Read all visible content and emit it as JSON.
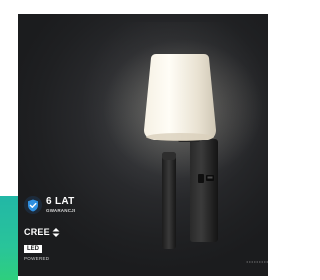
{
  "badges": {
    "warranty": {
      "big": "6 LAT",
      "small": "GWARANCJI",
      "icon": "shield-check-icon"
    },
    "cree": {
      "brand": "CREE",
      "led": "LED",
      "powered": "POWERED",
      "icon": "cree-arrows-icon"
    }
  },
  "colors": {
    "background": "#1f2022",
    "accent": "#29c49a",
    "shield": "#2f8fe0"
  }
}
